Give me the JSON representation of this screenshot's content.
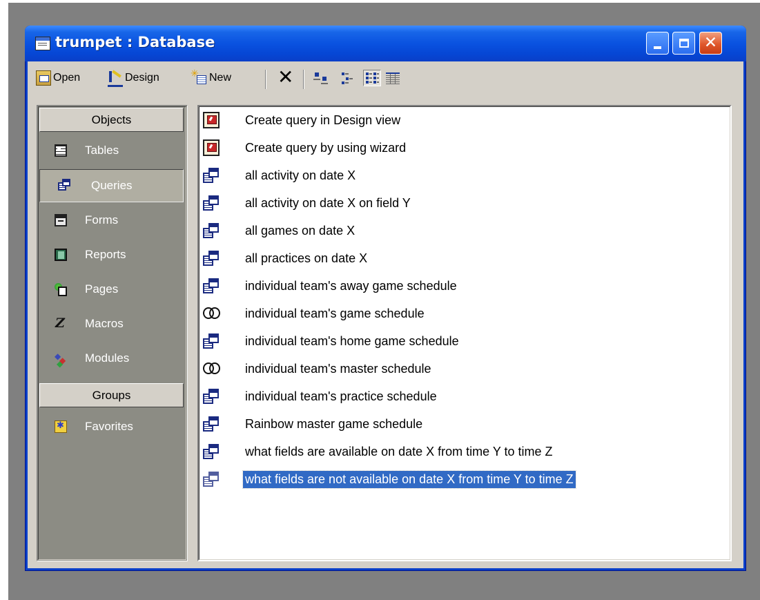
{
  "window": {
    "title": "trumpet : Database"
  },
  "toolbar": {
    "open_label": "Open",
    "design_label": "Design",
    "new_label": "New"
  },
  "sidebar": {
    "objects_header": "Objects",
    "groups_header": "Groups",
    "objects": [
      {
        "label": "Tables",
        "icon": "table-icon"
      },
      {
        "label": "Queries",
        "icon": "query-icon",
        "selected": true
      },
      {
        "label": "Forms",
        "icon": "form-icon"
      },
      {
        "label": "Reports",
        "icon": "report-icon"
      },
      {
        "label": "Pages",
        "icon": "page-icon"
      },
      {
        "label": "Macros",
        "icon": "macro-icon"
      },
      {
        "label": "Modules",
        "icon": "module-icon"
      }
    ],
    "groups": [
      {
        "label": "Favorites",
        "icon": "favorites-folder-icon"
      }
    ]
  },
  "list": {
    "items": [
      {
        "label": "Create query in Design view",
        "icon": "wizard-icon"
      },
      {
        "label": "Create query by using wizard",
        "icon": "wizard-icon"
      },
      {
        "label": "all activity on date X",
        "icon": "select-query-icon"
      },
      {
        "label": "all activity on date X on field Y",
        "icon": "select-query-icon"
      },
      {
        "label": "all games on date X",
        "icon": "select-query-icon"
      },
      {
        "label": "all practices on date X",
        "icon": "select-query-icon"
      },
      {
        "label": "individual team's away game schedule",
        "icon": "select-query-icon"
      },
      {
        "label": "individual team's game schedule",
        "icon": "union-query-icon"
      },
      {
        "label": "individual team's home game schedule",
        "icon": "select-query-icon"
      },
      {
        "label": "individual team's master schedule",
        "icon": "union-query-icon"
      },
      {
        "label": "individual team's practice schedule",
        "icon": "select-query-icon"
      },
      {
        "label": "Rainbow master game schedule",
        "icon": "select-query-icon"
      },
      {
        "label": "what fields are available on date X from time Y to time Z",
        "icon": "select-query-icon"
      },
      {
        "label": "what fields are not available on date X from time Y to time Z",
        "icon": "select-query-icon",
        "selected": true
      }
    ]
  },
  "colors": {
    "titlebar": "#0a52e0",
    "face": "#d4d0c8",
    "sidebar_bg": "#8c8c84",
    "selection": "#316ac5",
    "close_button": "#e0582c"
  }
}
